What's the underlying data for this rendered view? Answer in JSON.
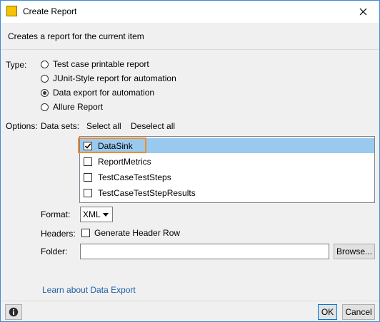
{
  "window": {
    "title": "Create Report",
    "description": "Creates a report for the current item"
  },
  "type_section": {
    "label": "Type:",
    "options": [
      {
        "label": "Test case printable report",
        "selected": false
      },
      {
        "label": "JUnit-Style report for automation",
        "selected": false
      },
      {
        "label": "Data export for automation",
        "selected": true
      },
      {
        "label": "Allure Report",
        "selected": false
      }
    ]
  },
  "options_section": {
    "label": "Options:",
    "datasets_label": "Data sets:",
    "select_all": "Select all",
    "deselect_all": "Deselect all",
    "datasets": [
      {
        "label": "DataSink",
        "checked": true
      },
      {
        "label": "ReportMetrics",
        "checked": false
      },
      {
        "label": "TestCaseTestSteps",
        "checked": false
      },
      {
        "label": "TestCaseTestStepResults",
        "checked": false
      }
    ]
  },
  "format": {
    "label": "Format:",
    "value": "XML"
  },
  "headers": {
    "label": "Headers:",
    "checkbox_label": "Generate Header Row",
    "checked": false
  },
  "folder": {
    "label": "Folder:",
    "value": "",
    "browse": "Browse..."
  },
  "learn_link": "Learn about Data Export",
  "buttons": {
    "ok": "OK",
    "cancel": "Cancel"
  },
  "colors": {
    "accent": "#3c8dd6",
    "selection": "#99c9ef",
    "highlight": "#f28c28",
    "link": "#1f5fa6"
  }
}
